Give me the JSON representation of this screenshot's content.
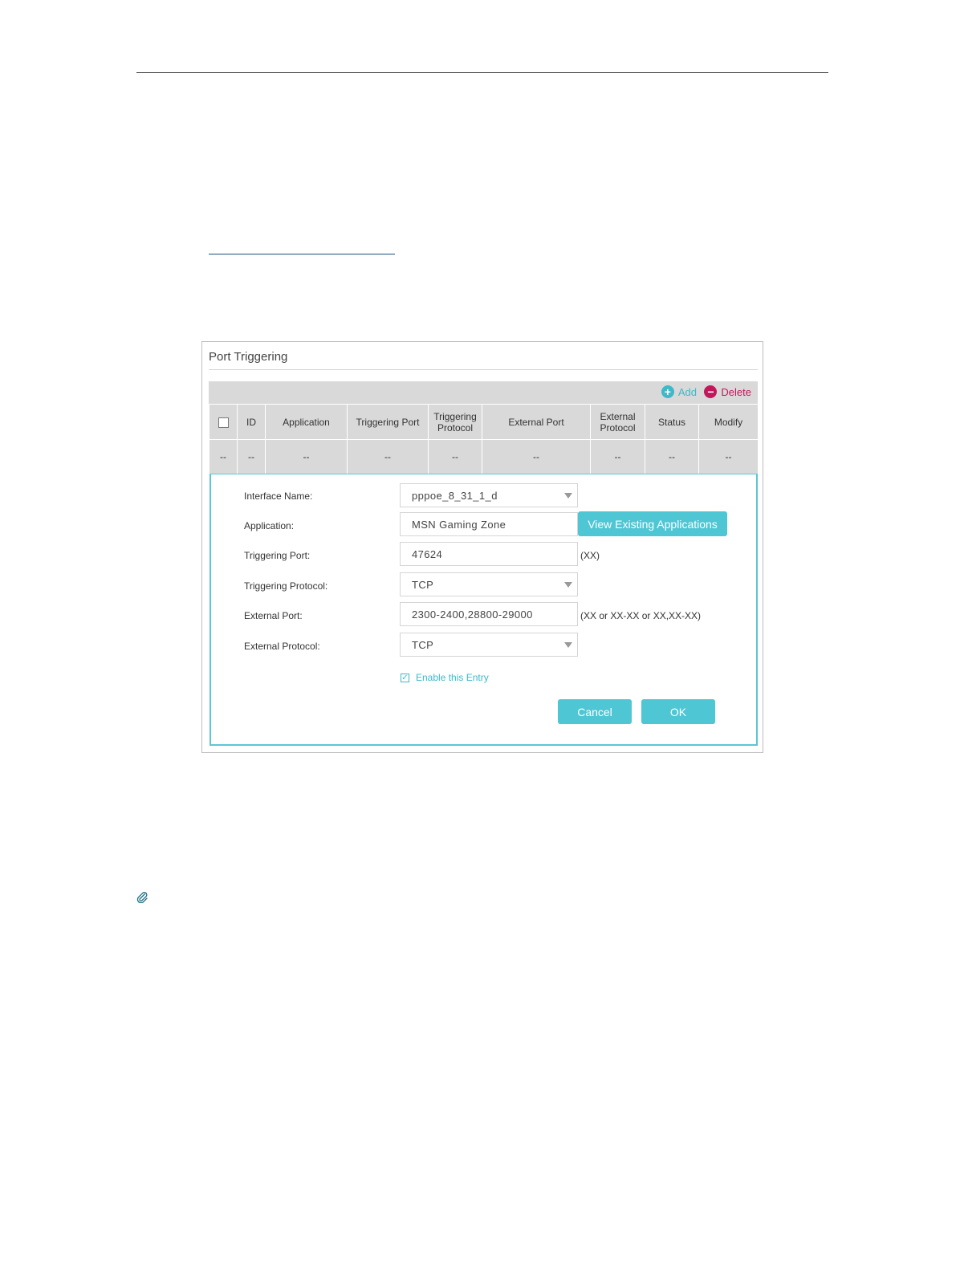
{
  "panel": {
    "title": "Port Triggering",
    "toolbar": {
      "add_label": "Add",
      "delete_label": "Delete"
    },
    "table": {
      "headers": [
        "ID",
        "Application",
        "Triggering Port",
        "Triggering Protocol",
        "External Port",
        "External Protocol",
        "Status",
        "Modify"
      ],
      "empty_row": [
        "--",
        "--",
        "--",
        "--",
        "--",
        "--",
        "--",
        "--",
        "--"
      ]
    },
    "form": {
      "interface_name": {
        "label": "Interface Name:",
        "value": "pppoe_8_31_1_d"
      },
      "application": {
        "label": "Application:",
        "value": "MSN Gaming Zone",
        "view_button": "View Existing Applications"
      },
      "triggering_port": {
        "label": "Triggering Port:",
        "value": "47624",
        "hint": "(XX)"
      },
      "triggering_protocol": {
        "label": "Triggering Protocol:",
        "value": "TCP"
      },
      "external_port": {
        "label": "External Port:",
        "value": "2300-2400,28800-29000",
        "hint": "(XX or XX-XX or XX,XX-XX)"
      },
      "external_protocol": {
        "label": "External Protocol:",
        "value": "TCP"
      },
      "enable_entry": {
        "label": "Enable this Entry",
        "checked": true
      },
      "cancel_label": "Cancel",
      "ok_label": "OK"
    }
  },
  "colors": {
    "accent": "#4fc6d4",
    "delete": "#c2185b",
    "table_bg": "#d9d9d9"
  },
  "icons": {
    "add": "plus-circle-icon",
    "delete": "minus-circle-icon",
    "note": "paperclip-icon"
  }
}
